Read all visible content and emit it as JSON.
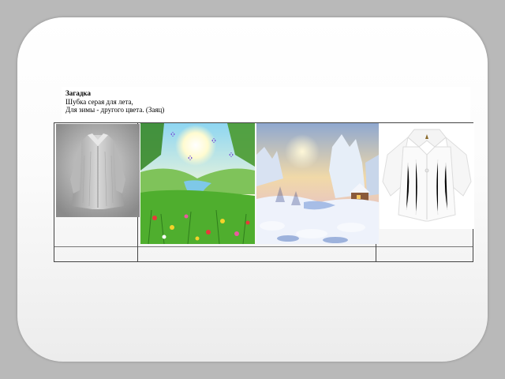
{
  "riddle": {
    "title": "Загадка",
    "line1": "Шубка серая для лета,",
    "line2": "Для зимы - другого цвета. (Заяц)"
  },
  "images": [
    {
      "name": "gray-fur-coat-image"
    },
    {
      "name": "summer-landscape-image"
    },
    {
      "name": "winter-landscape-image"
    },
    {
      "name": "white-fur-jacket-image"
    }
  ]
}
